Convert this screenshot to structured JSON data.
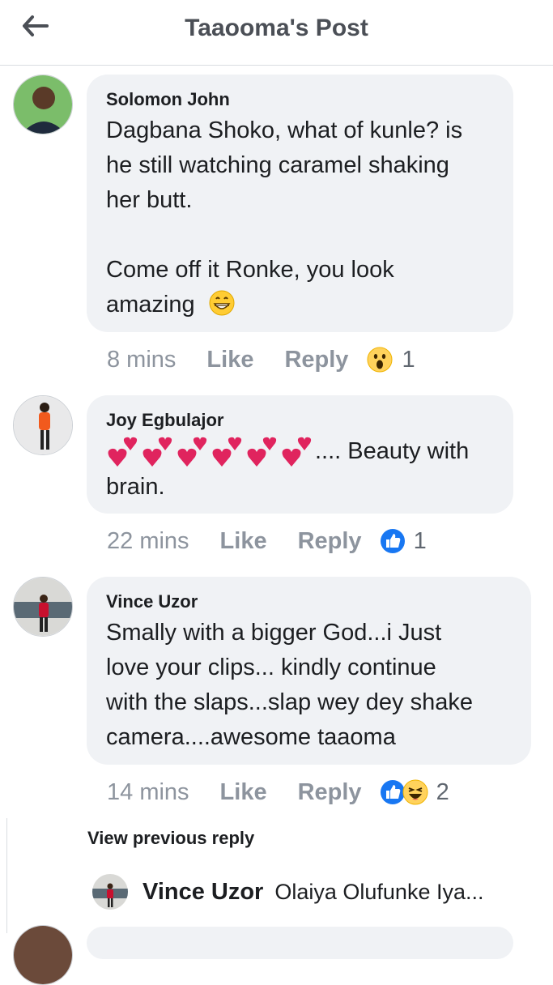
{
  "header": {
    "title": "Taaooma's Post",
    "back_icon": "arrow-left-icon"
  },
  "comments": [
    {
      "author": "Solomon John",
      "lines": [
        "Dagbana Shoko, what of kunle? is",
        "he still watching caramel shaking",
        "her butt.",
        "",
        "Come off it Ronke, you look",
        "amazing"
      ],
      "emoji": "grinning-face-icon",
      "time": "8 mins",
      "like": "Like",
      "reply": "Reply",
      "reactions": [
        "wow-icon"
      ],
      "reaction_count": "1"
    },
    {
      "author": "Joy Egbulajor",
      "hearts_suffix": ".... Beauty with",
      "line2": "brain.",
      "hearts": 6,
      "time": "22 mins",
      "like": "Like",
      "reply": "Reply",
      "reactions": [
        "like-icon"
      ],
      "reaction_count": "1"
    },
    {
      "author": "Vince Uzor",
      "lines": [
        "Smally with a bigger God...i Just",
        "love your clips... kindly continue",
        "with the slaps...slap wey dey shake",
        "camera....awesome taaoma"
      ],
      "time": "14 mins",
      "like": "Like",
      "reply": "Reply",
      "reactions": [
        "like-icon",
        "haha-icon"
      ],
      "reaction_count": "2"
    }
  ],
  "view_previous": "View previous reply",
  "reply_preview": {
    "author": "Vince Uzor",
    "text": "Olaiya Olufunke Iya..."
  },
  "colors": {
    "bubble": "#f0f2f5",
    "meta": "#8d949e",
    "like_blue": "#1877f2",
    "heart_red": "#e0245e"
  }
}
